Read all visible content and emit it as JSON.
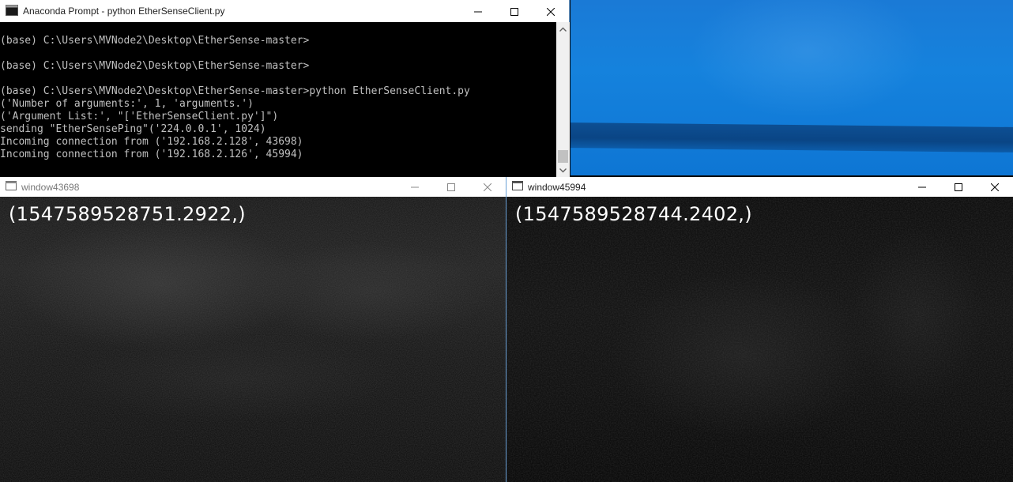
{
  "console": {
    "title": "Anaconda Prompt - python  EtherSenseClient.py",
    "icon": "console-icon",
    "lines": [
      "",
      "(base) C:\\Users\\MVNode2\\Desktop\\EtherSense-master>",
      "",
      "(base) C:\\Users\\MVNode2\\Desktop\\EtherSense-master>",
      "",
      "(base) C:\\Users\\MVNode2\\Desktop\\EtherSense-master>python EtherSenseClient.py",
      "('Number of arguments:', 1, 'arguments.')",
      "('Argument List:', \"['EtherSenseClient.py']\")",
      "sending \"EtherSensePing\"('224.0.0.1', 1024)",
      "Incoming connection from ('192.168.2.128', 43698)",
      "Incoming connection from ('192.168.2.126', 45994)"
    ]
  },
  "window1": {
    "title": "window43698",
    "timestamp": "(1547589528751.2922,)"
  },
  "window2": {
    "title": "window45994",
    "timestamp": "(1547589528744.2402,)"
  },
  "colors": {
    "console_bg": "#000000",
    "console_text": "#c0c0c0",
    "desktop_blue": "#1582dd",
    "titlebar_bg": "#ffffff"
  }
}
